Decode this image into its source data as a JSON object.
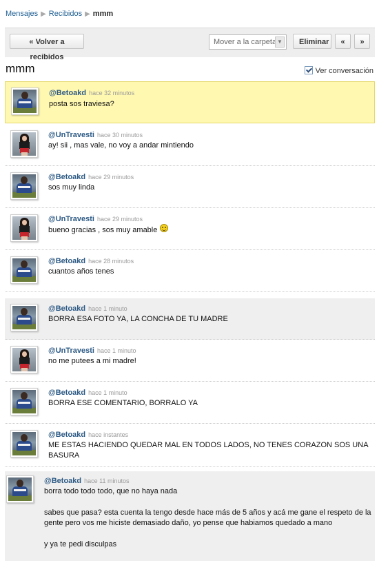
{
  "breadcrumb": {
    "item1": "Mensajes",
    "item2": "Recibidos",
    "current": "mmm"
  },
  "toolbar": {
    "back_label": "« Volver a recibidos",
    "folder_select_value": "Mover a la carpeta",
    "delete_label": "Eliminar",
    "prev_label": "«",
    "next_label": "»"
  },
  "conversation": {
    "title": "mmm",
    "view_label": "Ver conversación",
    "view_checked": true
  },
  "messages": [
    {
      "user": "@Betoakd",
      "time": "hace 32 minutos",
      "text": "posta sos traviesa?",
      "avatar": "betoakd-avatar"
    },
    {
      "user": "@UnTravesti",
      "time": "hace 30 minutos",
      "text": "ay! sii , mas vale, no voy a andar mintiendo",
      "avatar": "untravesti-avatar"
    },
    {
      "user": "@Betoakd",
      "time": "hace 29 minutos",
      "text": "sos muy linda",
      "avatar": "betoakd-avatar"
    },
    {
      "user": "@UnTravesti",
      "time": "hace 29 minutos",
      "text": "bueno gracias , sos muy amable",
      "avatar": "untravesti-avatar",
      "emoticon": "smiley-icon"
    },
    {
      "user": "@Betoakd",
      "time": "hace 28 minutos",
      "text": "cuantos años tenes",
      "avatar": "betoakd-avatar"
    },
    {
      "user": "@Betoakd",
      "time": "hace 1 minuto",
      "text": "BORRA ESA FOTO YA, LA CONCHA DE TU MADRE",
      "avatar": "betoakd-avatar"
    },
    {
      "user": "@UnTravesti",
      "time": "hace 1 minuto",
      "text": "no me putees a mi madre!",
      "avatar": "untravesti-avatar"
    },
    {
      "user": "@Betoakd",
      "time": "hace 1 minuto",
      "text": "BORRA ESE COMENTARIO, BORRALO YA",
      "avatar": "betoakd-avatar"
    },
    {
      "user": "@Betoakd",
      "time": "hace instantes",
      "text_line1": "ME ESTAS HACIENDO QUEDAR MAL EN TODOS LADOS, NO TENES CORAZON SOS UNA",
      "text_line2": "BASURA",
      "avatar": "betoakd-avatar"
    },
    {
      "user": "@Betoakd",
      "time": "hace 11 minutos",
      "text_p1": "borra todo todo todo, que no haya nada",
      "text_p2_line1": "sabes que pasa? esta cuenta la tengo desde hace más de 5 años y acá me gane el respeto de la",
      "text_p2_line2": "gente pero vos me hiciste demasiado daño, yo pense que habiamos quedado a mano",
      "text_p3": "y ya te pedi disculpas",
      "avatar": "betoakd-avatar"
    }
  ],
  "colors": {
    "link": "#2d5a85",
    "highlight_bg": "#fff8b1",
    "grey_bg": "#efefef"
  }
}
